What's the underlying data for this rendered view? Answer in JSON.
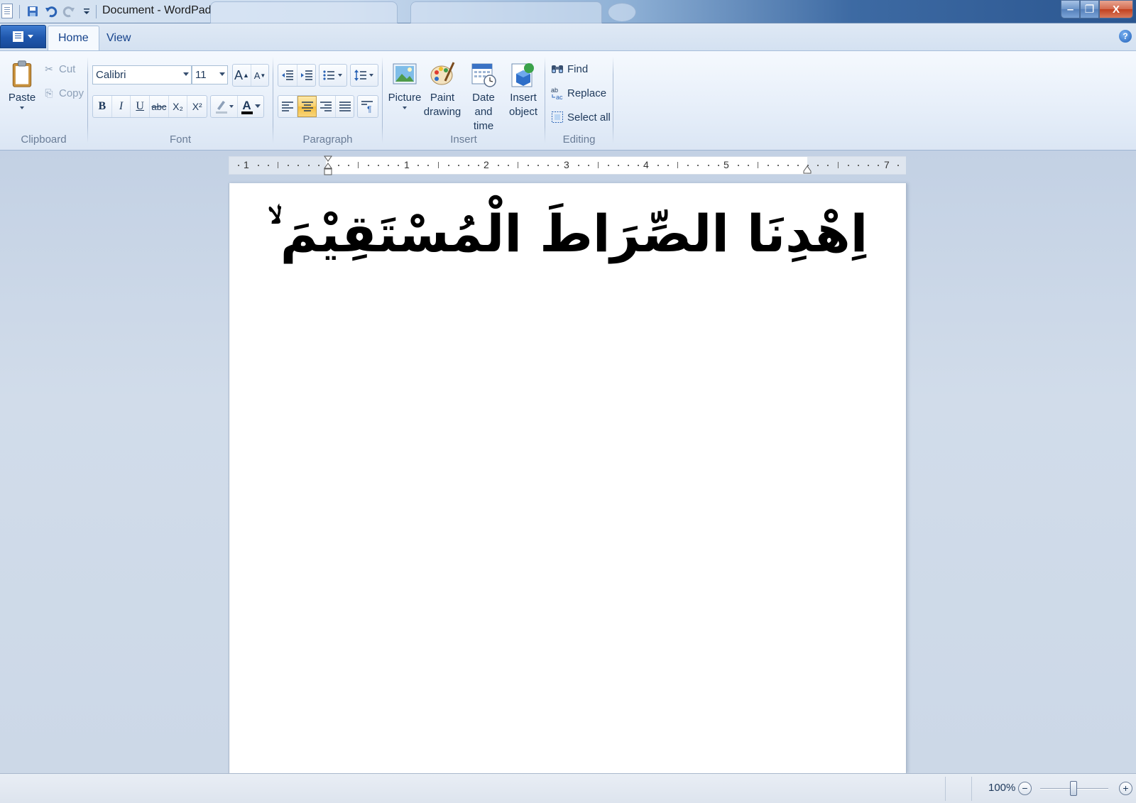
{
  "titlebar": {
    "title": "Document - WordPad",
    "minimize": "‒",
    "maximize": "❐",
    "close": "X"
  },
  "tabs": {
    "home": "Home",
    "view": "View",
    "help": "?"
  },
  "ribbon": {
    "clipboard": {
      "label": "Clipboard",
      "paste": "Paste",
      "cut": "Cut",
      "copy": "Copy"
    },
    "font": {
      "label": "Font",
      "family": "Calibri",
      "size": "11",
      "grow": "A",
      "shrink": "A",
      "bold": "B",
      "italic": "I",
      "underline": "U",
      "strike": "abc",
      "subscript": "X₂",
      "superscript": "X²",
      "color_glyph": "A"
    },
    "paragraph": {
      "label": "Paragraph",
      "active_alignment": "center"
    },
    "insert": {
      "label": "Insert",
      "picture": "Picture",
      "paint_line1": "Paint",
      "paint_line2": "drawing",
      "date_line1": "Date and",
      "date_line2": "time",
      "object_line1": "Insert",
      "object_line2": "object"
    },
    "editing": {
      "label": "Editing",
      "find": "Find",
      "replace": "Replace",
      "select_all": "Select all"
    }
  },
  "ruler": {
    "numbers": [
      "1",
      "1",
      "2",
      "3",
      "4",
      "5",
      "7"
    ]
  },
  "document": {
    "text": "اِهْدِنَا الصِّرَاطَ الْمُسْتَقِيْمَ ۙ"
  },
  "status": {
    "zoom": "100%",
    "zoom_out": "−",
    "zoom_in": "+"
  },
  "colors": {
    "accent": "#1f57ad",
    "active_button": "#f8cf6c",
    "close_button": "#c2411f"
  }
}
